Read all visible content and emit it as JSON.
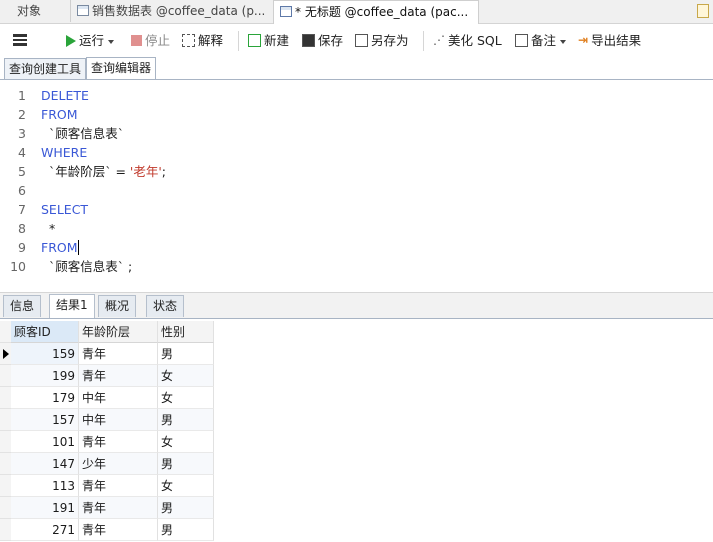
{
  "tabs": [
    {
      "label": "对象"
    },
    {
      "label": "销售数据表 @coffee_data (p..."
    },
    {
      "label": "* 无标题 @coffee_data (pac..."
    }
  ],
  "toolbar": {
    "run": "运行",
    "stop": "停止",
    "explain": "解释",
    "new": "新建",
    "save": "保存",
    "save_as": "另存为",
    "beautify": "美化 SQL",
    "comment": "备注",
    "export": "导出结果"
  },
  "subtabs": [
    "查询创建工具",
    "查询编辑器"
  ],
  "editor": {
    "lines": [
      {
        "n": "1",
        "kw": "DELETE"
      },
      {
        "n": "2",
        "kw": "FROM"
      },
      {
        "n": "3",
        "text": "`顾客信息表`"
      },
      {
        "n": "4",
        "kw": "WHERE"
      },
      {
        "n": "5",
        "text": "`年龄阶层` = ",
        "str": "'老年'",
        "tail": ";"
      },
      {
        "n": "6"
      },
      {
        "n": "7",
        "kw": "SELECT"
      },
      {
        "n": "8",
        "text": "*"
      },
      {
        "n": "9",
        "kw": "FROM"
      },
      {
        "n": "10",
        "text": "`顾客信息表` ;"
      }
    ]
  },
  "result_tabs": [
    "信息",
    "结果1",
    "概况",
    "状态"
  ],
  "grid": {
    "columns": [
      "顾客ID",
      "年龄阶层",
      "性别"
    ],
    "rows": [
      [
        "159",
        "青年",
        "男"
      ],
      [
        "199",
        "青年",
        "女"
      ],
      [
        "179",
        "中年",
        "女"
      ],
      [
        "157",
        "中年",
        "男"
      ],
      [
        "101",
        "青年",
        "女"
      ],
      [
        "147",
        "少年",
        "男"
      ],
      [
        "113",
        "青年",
        "女"
      ],
      [
        "191",
        "青年",
        "男"
      ],
      [
        "271",
        "青年",
        "男"
      ]
    ]
  },
  "colors": {
    "keyword": "#3a58d6",
    "string": "#c0392b",
    "run_icon": "#2aa43a",
    "stop_icon": "#e0908f"
  }
}
